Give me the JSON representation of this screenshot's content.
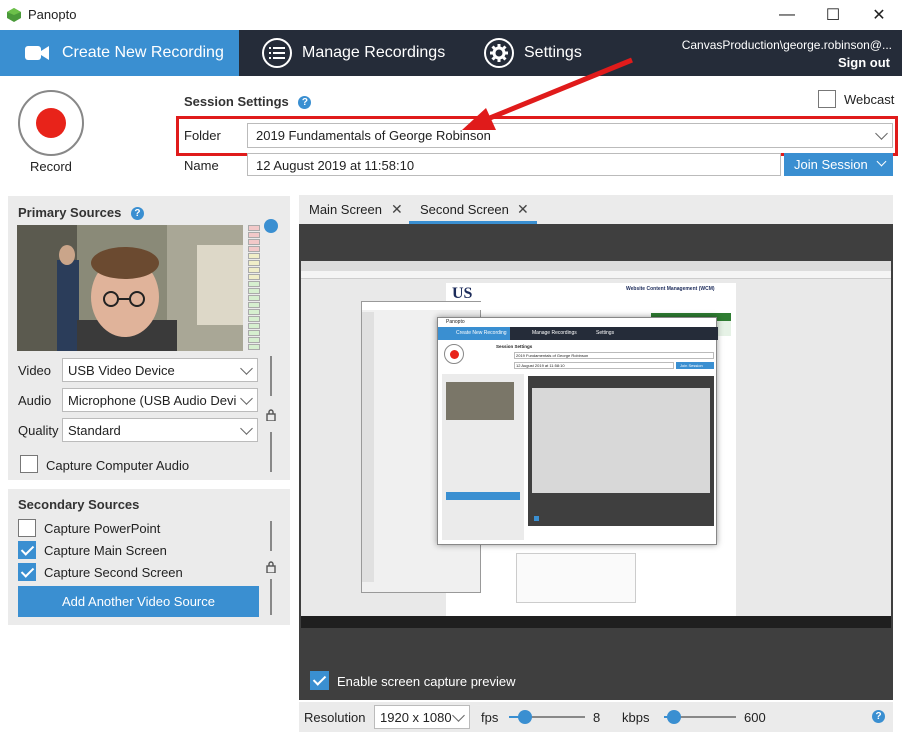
{
  "window": {
    "title": "Panopto",
    "minimize": "—",
    "maximize": "☐",
    "close": "✕"
  },
  "nav": {
    "tabs": [
      {
        "label": "Create New Recording",
        "icon": "camera-icon"
      },
      {
        "label": "Manage Recordings",
        "icon": "list-icon"
      },
      {
        "label": "Settings",
        "icon": "gear-icon"
      }
    ],
    "user": "CanvasProduction\\george.robinson@...",
    "sign_out": "Sign out"
  },
  "record": {
    "label": "Record"
  },
  "session": {
    "title": "Session Settings",
    "webcast_label": "Webcast",
    "folder_label": "Folder",
    "folder_value": "2019 Fundamentals of George Robinson",
    "name_label": "Name",
    "name_value": "12 August 2019 at 11:58:10",
    "join_label": "Join Session"
  },
  "primary": {
    "title": "Primary Sources",
    "video_label": "Video",
    "video_value": "USB Video Device",
    "audio_label": "Audio",
    "audio_value": "Microphone (USB Audio Devi",
    "quality_label": "Quality",
    "quality_value": "Standard",
    "capture_audio_label": "Capture Computer Audio",
    "capture_audio_checked": false
  },
  "secondary": {
    "title": "Secondary Sources",
    "items": [
      {
        "label": "Capture PowerPoint",
        "checked": false
      },
      {
        "label": "Capture Main Screen",
        "checked": true
      },
      {
        "label": "Capture Second Screen",
        "checked": true
      }
    ],
    "add_label": "Add Another Video Source"
  },
  "preview": {
    "tabs": [
      {
        "label": "Main Screen",
        "close": "✕"
      },
      {
        "label": "Second Screen",
        "close": "✕"
      }
    ],
    "enable_label": "Enable screen capture preview",
    "enable_checked": true,
    "shot": {
      "site_logo": "US",
      "site_title": "Website Content Management (WCM)",
      "inner_title": "Panopto",
      "inner_tab": "Create New Recording",
      "inner_tab2": "Manage Recordings",
      "inner_tab3": "Settings",
      "inner_session": "Session Settings",
      "inner_folder": "2019 Fundamentals of George Robinson",
      "inner_name": "12 August 2019 at 11:58:10",
      "inner_join": "Join Session"
    }
  },
  "bottom": {
    "resolution_label": "Resolution",
    "resolution_value": "1920 x 1080",
    "fps_label": "fps",
    "fps_value": "8",
    "kbps_label": "kbps",
    "kbps_value": "600",
    "help": "?"
  },
  "colors": {
    "accent": "#3a8fd1",
    "nav_bg": "#252c39",
    "record": "#e8231a",
    "highlight": "#e01b1b"
  }
}
